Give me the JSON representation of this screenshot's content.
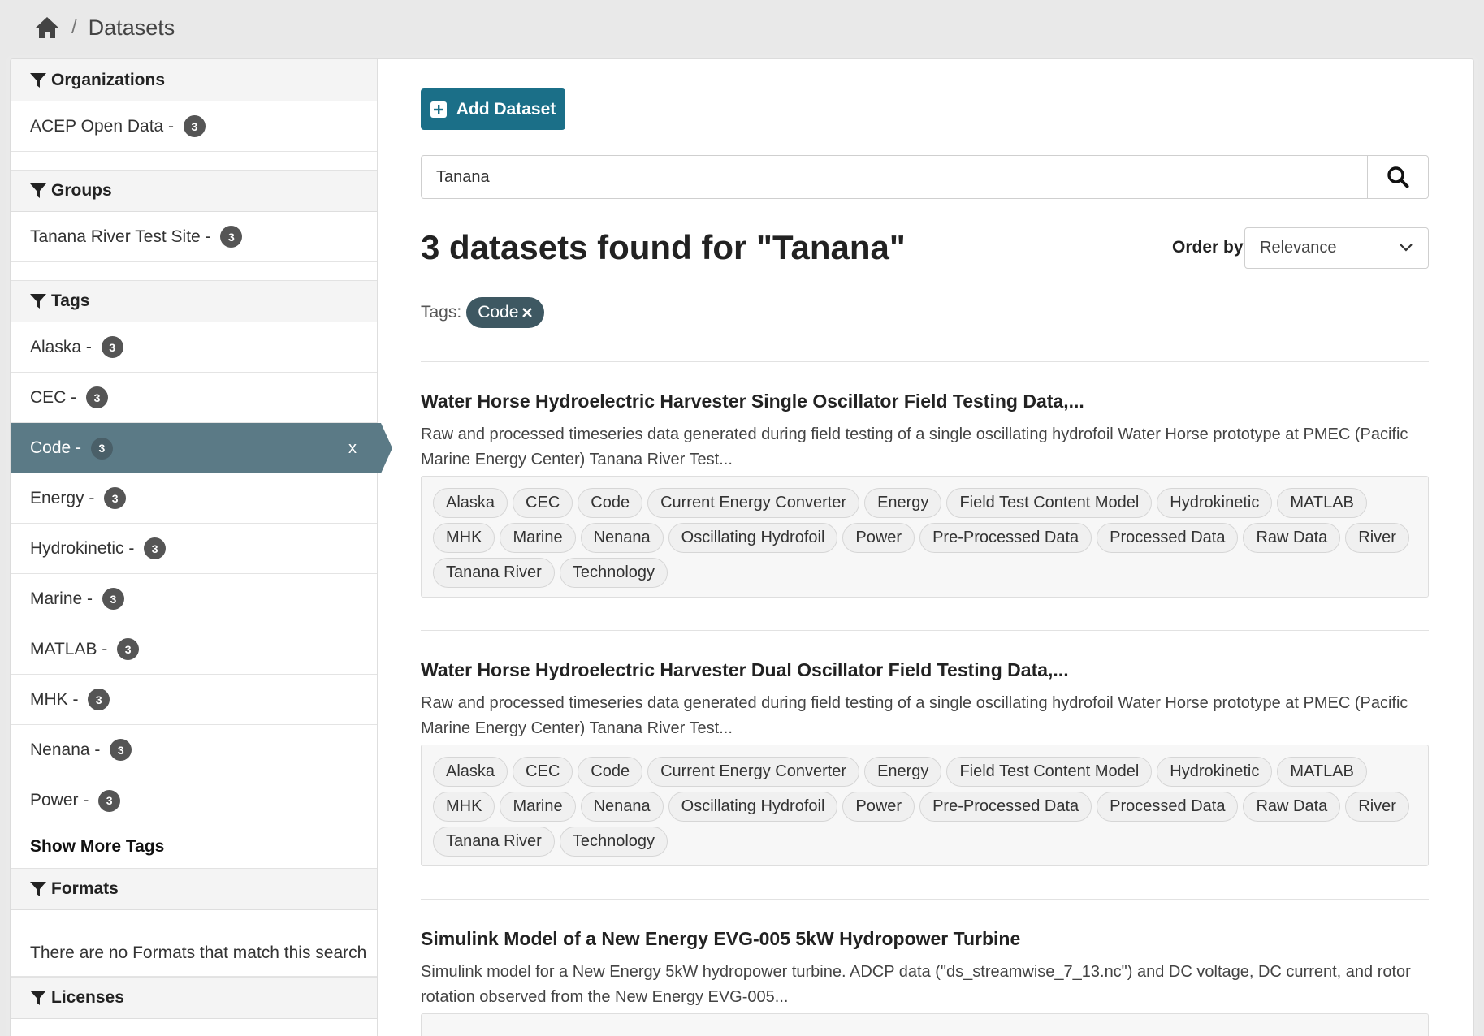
{
  "breadcrumb": {
    "current": "Datasets"
  },
  "sidebar": {
    "organizations": {
      "heading": "Organizations",
      "items": [
        {
          "label": "ACEP Open Data - ",
          "count": "3"
        }
      ]
    },
    "groups": {
      "heading": "Groups",
      "items": [
        {
          "label": "Tanana River Test Site - ",
          "count": "3"
        }
      ]
    },
    "tags": {
      "heading": "Tags",
      "items": [
        {
          "label": "Alaska - ",
          "count": "3"
        },
        {
          "label": "CEC - ",
          "count": "3"
        },
        {
          "label": "Code - ",
          "count": "3",
          "remove": "x"
        },
        {
          "label": "Energy - ",
          "count": "3"
        },
        {
          "label": "Hydrokinetic - ",
          "count": "3"
        },
        {
          "label": "Marine - ",
          "count": "3"
        },
        {
          "label": "MATLAB - ",
          "count": "3"
        },
        {
          "label": "MHK - ",
          "count": "3"
        },
        {
          "label": "Nenana - ",
          "count": "3"
        },
        {
          "label": "Power - ",
          "count": "3"
        }
      ],
      "show_more": "Show More Tags"
    },
    "formats": {
      "heading": "Formats",
      "empty": "There are no Formats that match this search"
    },
    "licenses": {
      "heading": "Licenses"
    }
  },
  "main": {
    "add_button": "Add Dataset",
    "search": {
      "value": "Tanana"
    },
    "results_title": "3 datasets found for \"Tanana\"",
    "order": {
      "label": "Order by:",
      "selected": "Relevance"
    },
    "active_tags": {
      "label": "Tags:",
      "pill": "Code"
    },
    "datasets": [
      {
        "title": "Water Horse Hydroelectric Harvester Single Oscillator Field Testing Data,...",
        "description": "Raw and processed timeseries data generated during field testing of a single oscillating hydrofoil Water Horse prototype at PMEC (Pacific Marine Energy Center) Tanana River Test...",
        "tags": [
          "Alaska",
          "CEC",
          "Code",
          "Current Energy Converter",
          "Energy",
          "Field Test Content Model",
          "Hydrokinetic",
          "MATLAB",
          "MHK",
          "Marine",
          "Nenana",
          "Oscillating Hydrofoil",
          "Power",
          "Pre-Processed Data",
          "Processed Data",
          "Raw Data",
          "River",
          "Tanana River",
          "Technology"
        ]
      },
      {
        "title": "Water Horse Hydroelectric Harvester Dual Oscillator Field Testing Data,...",
        "description": "Raw and processed timeseries data generated during field testing of a single oscillating hydrofoil Water Horse prototype at PMEC (Pacific Marine Energy Center) Tanana River Test...",
        "tags": [
          "Alaska",
          "CEC",
          "Code",
          "Current Energy Converter",
          "Energy",
          "Field Test Content Model",
          "Hydrokinetic",
          "MATLAB",
          "MHK",
          "Marine",
          "Nenana",
          "Oscillating Hydrofoil",
          "Power",
          "Pre-Processed Data",
          "Processed Data",
          "Raw Data",
          "River",
          "Tanana River",
          "Technology"
        ]
      },
      {
        "title": "Simulink Model of a New Energy EVG-005 5kW Hydropower Turbine",
        "description": "Simulink model for a New Energy 5kW hydropower turbine. ADCP data (\"ds_streamwise_7_13.nc\") and DC voltage, DC current, and rotor rotation observed from the New Energy EVG-005...",
        "tags": []
      }
    ]
  }
}
